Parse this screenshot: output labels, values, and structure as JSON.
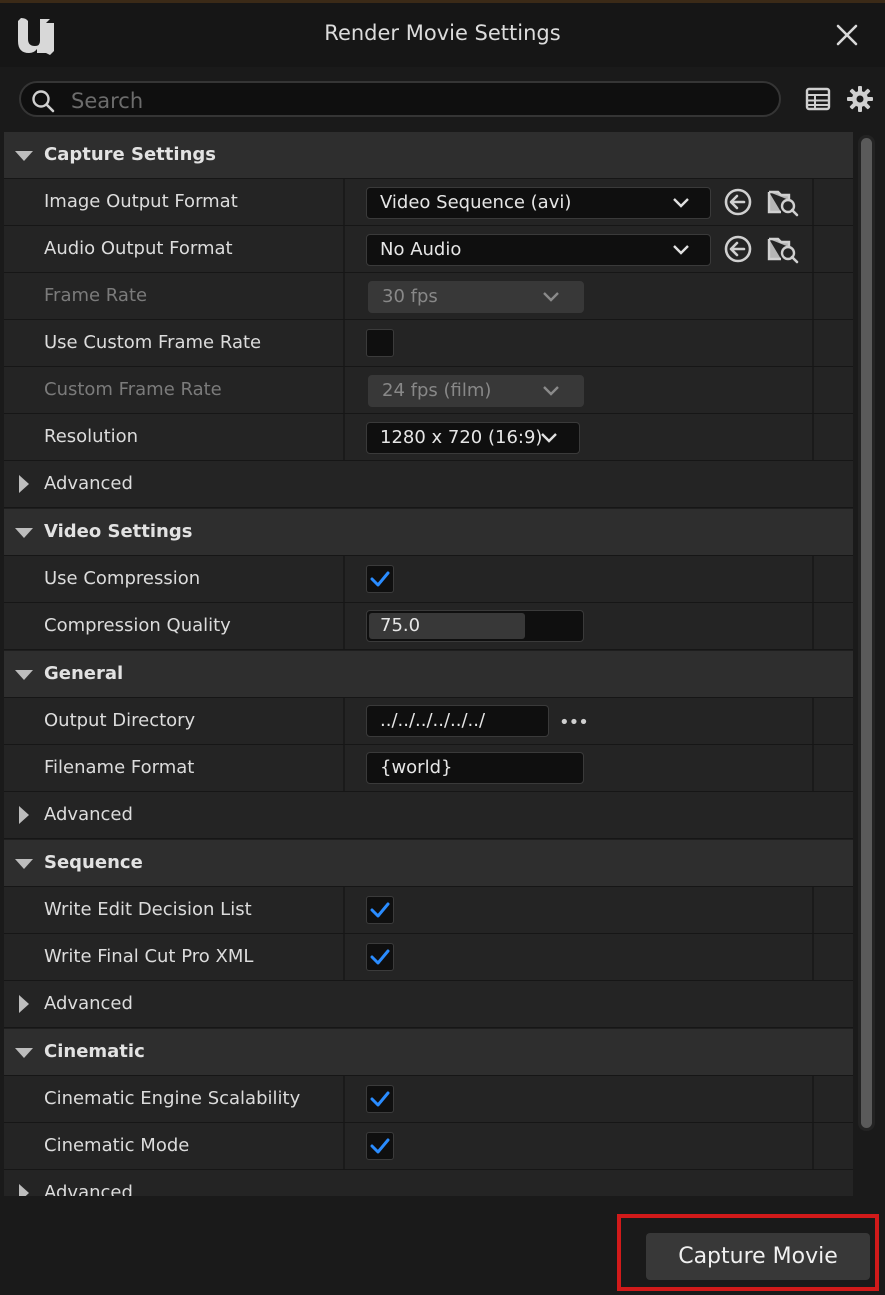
{
  "window": {
    "title": "Render Movie Settings",
    "logo": "unreal-engine-logo"
  },
  "search": {
    "placeholder": "Search"
  },
  "sections": {
    "capture": {
      "title": "Capture Settings",
      "image_output_format": {
        "label": "Image Output Format",
        "value": "Video Sequence (avi)"
      },
      "audio_output_format": {
        "label": "Audio Output Format",
        "value": "No Audio"
      },
      "frame_rate": {
        "label": "Frame Rate",
        "value": "30 fps"
      },
      "use_custom_frame_rate": {
        "label": "Use Custom Frame Rate",
        "checked": false
      },
      "custom_frame_rate": {
        "label": "Custom Frame Rate",
        "value": "24 fps (film)"
      },
      "resolution": {
        "label": "Resolution",
        "value": "1280 x 720 (16:9)"
      },
      "advanced": "Advanced"
    },
    "video": {
      "title": "Video Settings",
      "use_compression": {
        "label": "Use Compression",
        "checked": true
      },
      "compression_quality": {
        "label": "Compression Quality",
        "value": "75.0",
        "fill_fraction": 0.72
      }
    },
    "general": {
      "title": "General",
      "output_directory": {
        "label": "Output Directory",
        "value": "../../../../../../"
      },
      "filename_format": {
        "label": "Filename Format",
        "value": "{world}"
      },
      "advanced": "Advanced"
    },
    "sequence": {
      "title": "Sequence",
      "write_edl": {
        "label": "Write Edit Decision List",
        "checked": true
      },
      "write_fcp_xml": {
        "label": "Write Final Cut Pro XML",
        "checked": true
      },
      "advanced": "Advanced"
    },
    "cinematic": {
      "title": "Cinematic",
      "engine_scalability": {
        "label": "Cinematic Engine Scalability",
        "checked": true
      },
      "cinematic_mode": {
        "label": "Cinematic Mode",
        "checked": true
      },
      "advanced": "Advanced"
    }
  },
  "footer": {
    "capture_button": "Capture Movie"
  },
  "colors": {
    "accent": "#2a8cff",
    "highlight_box": "#d11a1a"
  }
}
